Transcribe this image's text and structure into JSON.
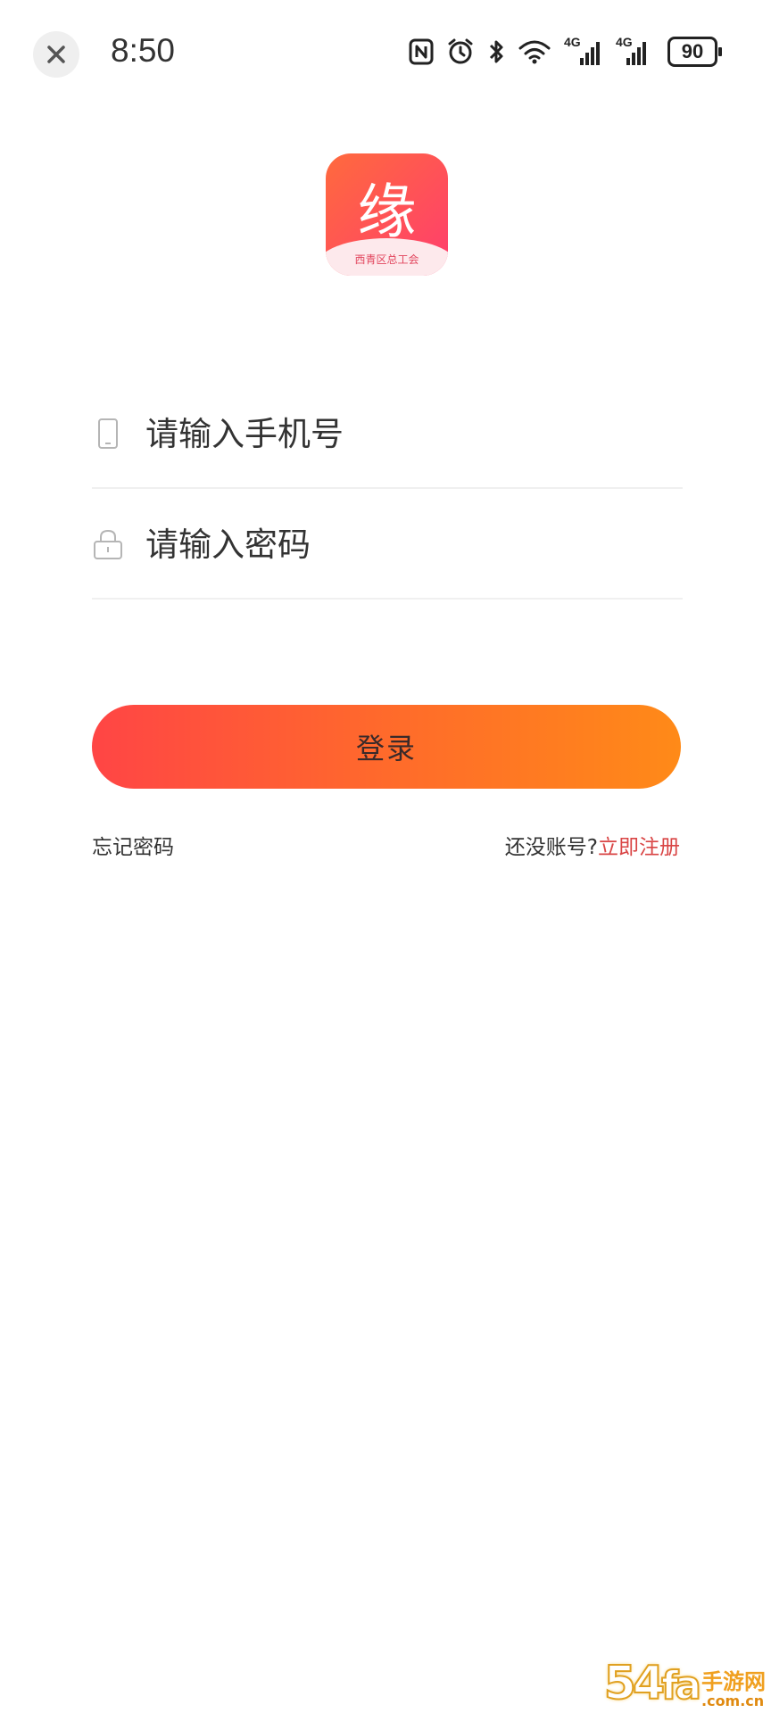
{
  "status_bar": {
    "time": "8:50",
    "battery": "90",
    "network_1": "4G",
    "network_2": "4G"
  },
  "logo": {
    "character": "缘",
    "subtitle": "西青区总工会",
    "gradient_start": "#ff6a3d",
    "gradient_end": "#ff3d6e"
  },
  "form": {
    "phone_placeholder": "请输入手机号",
    "password_placeholder": "请输入密码",
    "phone_icon": "phone-icon",
    "password_icon": "lock-icon"
  },
  "login_button": {
    "label": "登录",
    "gradient_start": "#ff4545",
    "gradient_end": "#ff8a18"
  },
  "links": {
    "forgot_password": "忘记密码",
    "no_account": "还没账号?",
    "register": "立即注册",
    "register_color": "#d94545"
  },
  "watermark": {
    "number": "54",
    "mark": "fa",
    "chinese": "手游网",
    "url": ".com.cn"
  }
}
